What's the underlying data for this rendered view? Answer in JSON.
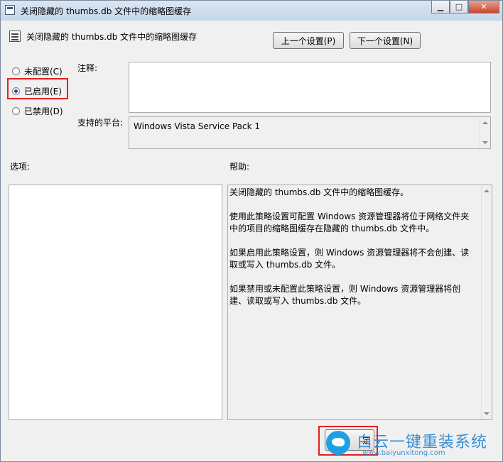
{
  "window": {
    "title": "关闭隐藏的 thumbs.db 文件中的缩略图缓存",
    "controls": {
      "minimize": "▁",
      "maximize": "□",
      "close": "✕"
    }
  },
  "header": {
    "policy_name": "关闭隐藏的 thumbs.db 文件中的缩略图缓存",
    "prev_button": "上一个设置(P)",
    "next_button": "下一个设置(N)"
  },
  "state": {
    "options": [
      {
        "label": "未配置(C)",
        "checked": false
      },
      {
        "label": "已启用(E)",
        "checked": true
      },
      {
        "label": "已禁用(D)",
        "checked": false
      }
    ]
  },
  "comment": {
    "label": "注释:",
    "value": ""
  },
  "platform": {
    "label": "支持的平台:",
    "value": "Windows Vista Service Pack 1"
  },
  "options_panel": {
    "label": "选项:"
  },
  "help_panel": {
    "label": "帮助:",
    "paragraphs": [
      "关闭隐藏的 thumbs.db 文件中的缩略图缓存。",
      "使用此策略设置可配置 Windows 资源管理器将位于网络文件夹中的项目的缩略图缓存在隐藏的 thumbs.db 文件中。",
      "如果启用此策略设置，则 Windows 资源管理器将不会创建、读取或写入 thumbs.db 文件。",
      "如果禁用或未配置此策略设置，则 Windows 资源管理器将创建、读取或写入 thumbs.db 文件。"
    ]
  },
  "footer": {
    "ok_button_partial": "定"
  },
  "watermark": {
    "text": "白云一键重装系统",
    "url": "www.baiyunxitong.com"
  },
  "colors": {
    "highlight_box": "#e02020",
    "radio_selected": "#1b4f8a"
  }
}
